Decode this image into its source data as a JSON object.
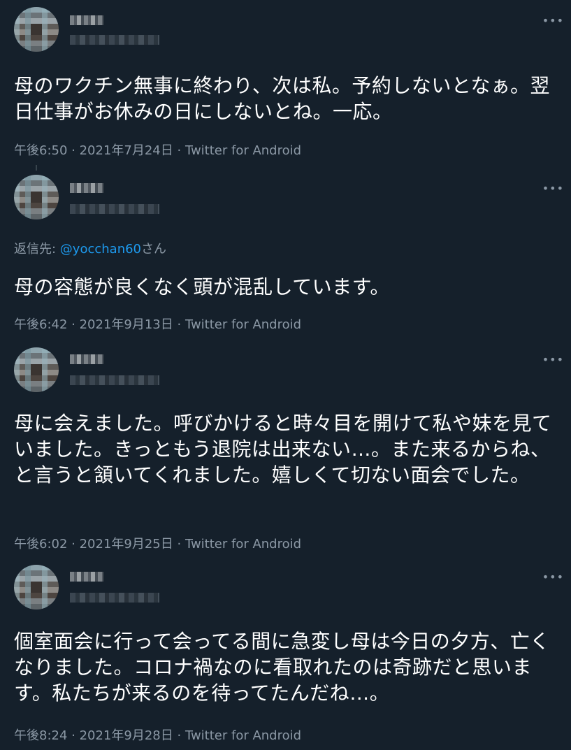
{
  "tweets": [
    {
      "text": "母のワクチン無事に終わり、次は私。予約しないとなぁ。翌日仕事がお休みの日にしないとね。一応。",
      "time": "午後6:50",
      "date": "2021年7月24日",
      "source": "Twitter for Android",
      "more": "•••"
    },
    {
      "reply_label": "返信先: ",
      "reply_mention": "@yocchan60",
      "reply_suffix": "さん",
      "text": "母の容態が良くなく頭が混乱しています。",
      "time": "午後6:42",
      "date": "2021年9月13日",
      "source": "Twitter for Android",
      "more": "•••"
    },
    {
      "text": "母に会えました。呼びかけると時々目を開けて私や妹を見ていました。きっともう退院は出来ない…。また来るからね、と言うと頷いてくれました。嬉しくて切ない面会でした。",
      "time": "午後6:02",
      "date": "2021年9月25日",
      "source": "Twitter for Android",
      "more": "•••"
    },
    {
      "text": "個室面会に行って会ってる間に急変し母は今日の夕方、亡くなりました。コロナ禍なのに看取れたのは奇跡だと思います。私たちが来るのを待ってたんだね…。",
      "time": "午後8:24",
      "date": "2021年9月28日",
      "source": "Twitter for Android",
      "more": "•••"
    }
  ],
  "separator": " · ",
  "colors": {
    "background": "#15202b",
    "text": "#ffffff",
    "secondary": "#8b98a5",
    "link": "#1d9bf0"
  }
}
